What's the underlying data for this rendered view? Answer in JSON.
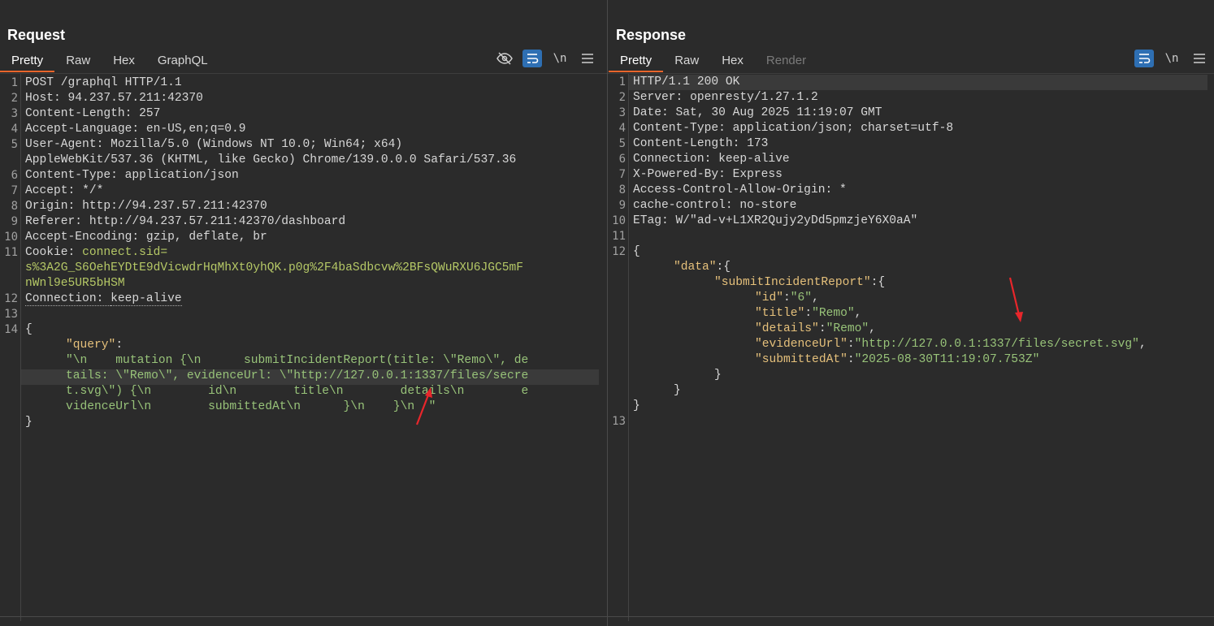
{
  "request": {
    "title": "Request",
    "tabs": [
      {
        "label": "Pretty",
        "active": true
      },
      {
        "label": "Raw",
        "active": false
      },
      {
        "label": "Hex",
        "active": false
      },
      {
        "label": "GraphQL",
        "active": false
      }
    ],
    "newline_label": "\\n",
    "line_numbers": [
      "1",
      "2",
      "3",
      "4",
      "5",
      "6",
      "7",
      "8",
      "9",
      "10",
      "11",
      "12",
      "13",
      "14"
    ],
    "lines": {
      "l1": "POST /graphql HTTP/1.1",
      "l2k": "Host: ",
      "l2v": "94.237.57.211:42370",
      "l3k": "Content-Length: ",
      "l3v": "257",
      "l4k": "Accept-Language: ",
      "l4v": "en-US,en;q=0.9",
      "l5k": "User-Agent: ",
      "l5v": "Mozilla/5.0 (Windows NT 10.0; Win64; x64)",
      "l5b": "AppleWebKit/537.36 (KHTML, like Gecko) Chrome/139.0.0.0 Safari/537.36",
      "l6k": "Content-Type: ",
      "l6v": "application/json",
      "l7k": "Accept: ",
      "l7v": "*/*",
      "l8k": "Origin: ",
      "l8v": "http://94.237.57.211:42370",
      "l9k": "Referer: ",
      "l9v": "http://94.237.57.211:42370/dashboard",
      "l10k": "Accept-Encoding: ",
      "l10v": "gzip, deflate, br",
      "l11k": "Cookie: ",
      "l11v": "connect.sid=",
      "l11b": "s%3A2G_S6OehEYDtE9dVicwdrHqMhXt0yhQK.p0g%2F4baSdbcvw%2BFsQWuRXU6JGC5mF",
      "l11c": "nWnl9e5UR5bHSM",
      "l12k": "Connection: ",
      "l12v": "keep-alive",
      "l14a": "{",
      "l14k": "\"query\"",
      "l14colon": ":",
      "q1": "\"\\n    mutation {\\n      submitIncidentReport(title: \\\"Remo\\\", de",
      "q2": "tails: \\\"Remo\\\", evidenceUrl: \\\"http://127.0.0.1:1337/files/secre",
      "q3": "t.svg\\\") {\\n        id\\n        title\\n        details\\n        e",
      "q4": "videnceUrl\\n        submittedAt\\n      }\\n    }\\n  \"",
      "lend": "}"
    }
  },
  "response": {
    "title": "Response",
    "tabs": [
      {
        "label": "Pretty",
        "active": true
      },
      {
        "label": "Raw",
        "active": false
      },
      {
        "label": "Hex",
        "active": false
      },
      {
        "label": "Render",
        "active": false
      }
    ],
    "newline_label": "\\n",
    "line_numbers": [
      "1",
      "2",
      "3",
      "4",
      "5",
      "6",
      "7",
      "8",
      "9",
      "10",
      "11",
      "12",
      "13"
    ],
    "lines": {
      "r1": "HTTP/1.1 200 OK",
      "r2k": "Server: ",
      "r2v": "openresty/1.27.1.2",
      "r3k": "Date: ",
      "r3v": "Sat, 30 Aug 2025 11:19:07 GMT",
      "r4k": "Content-Type: ",
      "r4v": "application/json; charset=utf-8",
      "r5k": "Content-Length: ",
      "r5v": "173",
      "r6k": "Connection: ",
      "r6v": "keep-alive",
      "r7k": "X-Powered-By: ",
      "r7v": "Express",
      "r8k": "Access-Control-Allow-Origin: ",
      "r8v": "*",
      "r9k": "cache-control: ",
      "r9v": "no-store",
      "r10k": "ETag: ",
      "r10v": "W/\"ad-v+L1XR2Qujy2yDd5pmzjeY6X0aA\"",
      "j1": "{",
      "j2k": "\"data\"",
      "j2r": ":{",
      "j3k": "\"submitIncidentReport\"",
      "j3r": ":{",
      "j4k": "\"id\"",
      "j4v": "\"6\"",
      "j5k": "\"title\"",
      "j5v": "\"Remo\"",
      "j6k": "\"details\"",
      "j6v": "\"Remo\"",
      "j7k": "\"evidenceUrl\"",
      "j7v": "\"http://127.0.0.1:1337/files/secret.svg\"",
      "j8k": "\"submittedAt\"",
      "j8v": "\"2025-08-30T11:19:07.753Z\"",
      "j9": "}",
      "j10": "}",
      "j11": "}",
      "colon": ":",
      "comma": ","
    }
  },
  "colors": {
    "accent_tab": "#e8652b",
    "active_tool": "#2e6fb3",
    "key": "#e5c07b",
    "string": "#98c379",
    "annotation_arrow": "#e8262b"
  }
}
